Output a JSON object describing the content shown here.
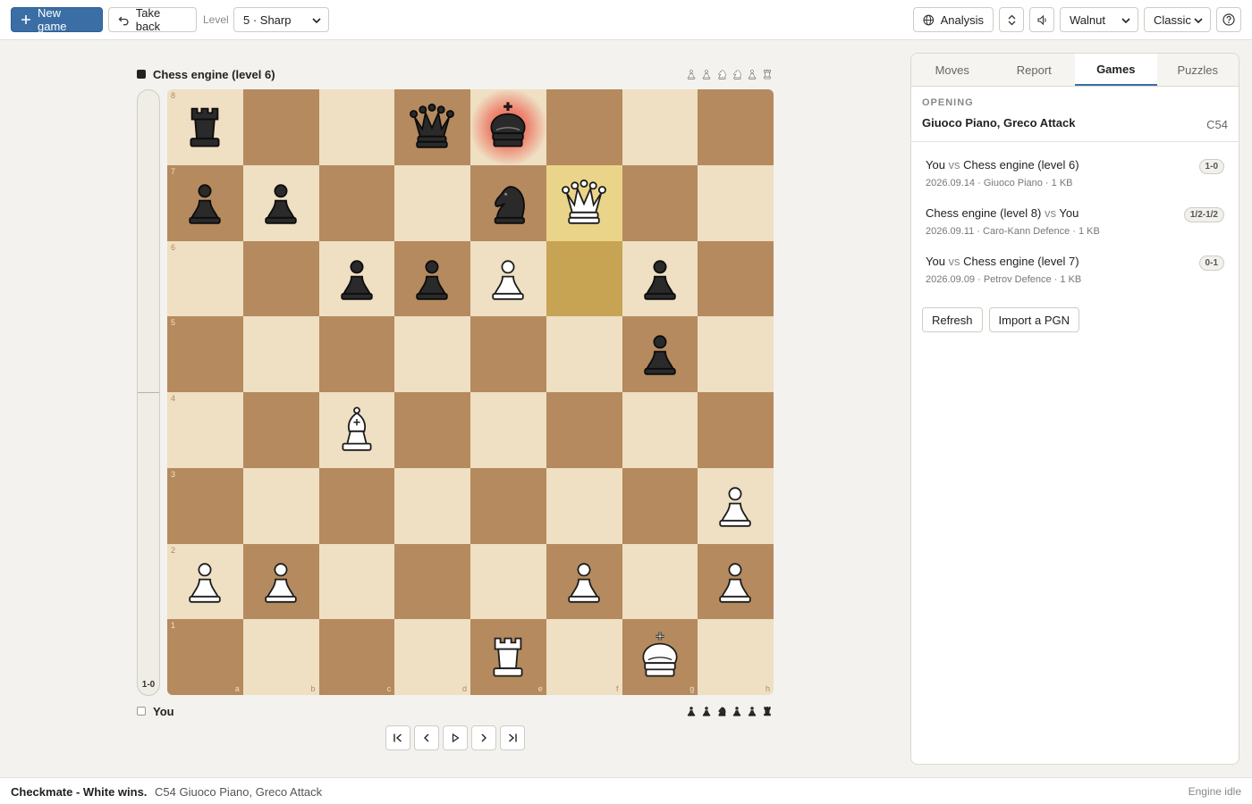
{
  "toolbar": {
    "new_game": "New game",
    "take_back": "Take back",
    "level_label": "Level",
    "level_value": "5 · Sharp",
    "analysis": "Analysis",
    "board_theme": "Walnut",
    "piece_set": "Classic"
  },
  "players": {
    "top": "Chess engine (level 6)",
    "bottom": "You"
  },
  "captured": {
    "top": [
      "wp",
      "wp",
      "wn",
      "wn",
      "wp",
      "wr"
    ],
    "bottom": [
      "bp",
      "bp",
      "bn",
      "bp",
      "bp",
      "br"
    ]
  },
  "eval": {
    "score": "1-0",
    "white_fraction": 1.0
  },
  "board": {
    "ranks": [
      "8",
      "7",
      "6",
      "5",
      "4",
      "3",
      "2",
      "1"
    ],
    "files": [
      "a",
      "b",
      "c",
      "d",
      "e",
      "f",
      "g",
      "h"
    ],
    "position": [
      [
        "br",
        "",
        "",
        "bq",
        "bk",
        "",
        "",
        ""
      ],
      [
        "bp",
        "bp",
        "",
        "",
        "bn",
        "wq",
        "",
        ""
      ],
      [
        "",
        "",
        "bp",
        "bp",
        "wp",
        "",
        "bp",
        ""
      ],
      [
        "",
        "",
        "",
        "",
        "",
        "",
        "bp",
        ""
      ],
      [
        "",
        "",
        "wb",
        "",
        "",
        "",
        "",
        ""
      ],
      [
        "",
        "",
        "",
        "",
        "",
        "",
        "",
        "wp"
      ],
      [
        "wp",
        "wp",
        "",
        "",
        "",
        "wp",
        "",
        "wp"
      ],
      [
        "",
        "",
        "",
        "",
        "wr",
        "",
        "wk",
        ""
      ]
    ],
    "last_move_from": "f6",
    "last_move_to": "f7",
    "check_square": "e8"
  },
  "panel": {
    "tabs": [
      "Moves",
      "Report",
      "Games",
      "Puzzles"
    ],
    "active_tab": "Games",
    "opening_label": "OPENING",
    "opening_name": "Giuoco Piano, Greco Attack",
    "opening_eco": "C54",
    "games": [
      {
        "left": "You",
        "vs": "vs",
        "right": "Chess engine (level 6)",
        "meta": "2026.09.14 · Giuoco Piano · 1 KB",
        "result": "1-0"
      },
      {
        "left": "Chess engine (level 8)",
        "vs": "vs",
        "right": "You",
        "meta": "2026.09.11 · Caro-Kann Defence · 1 KB",
        "result": "1/2-1/2"
      },
      {
        "left": "You",
        "vs": "vs",
        "right": "Chess engine (level 7)",
        "meta": "2026.09.09 · Petrov Defence · 1 KB",
        "result": "0-1"
      }
    ],
    "refresh": "Refresh",
    "import_pgn": "Import a PGN"
  },
  "status": {
    "main": "Checkmate - White wins.",
    "opening": "C54 Giuoco Piano, Greco Attack",
    "engine": "Engine idle"
  }
}
